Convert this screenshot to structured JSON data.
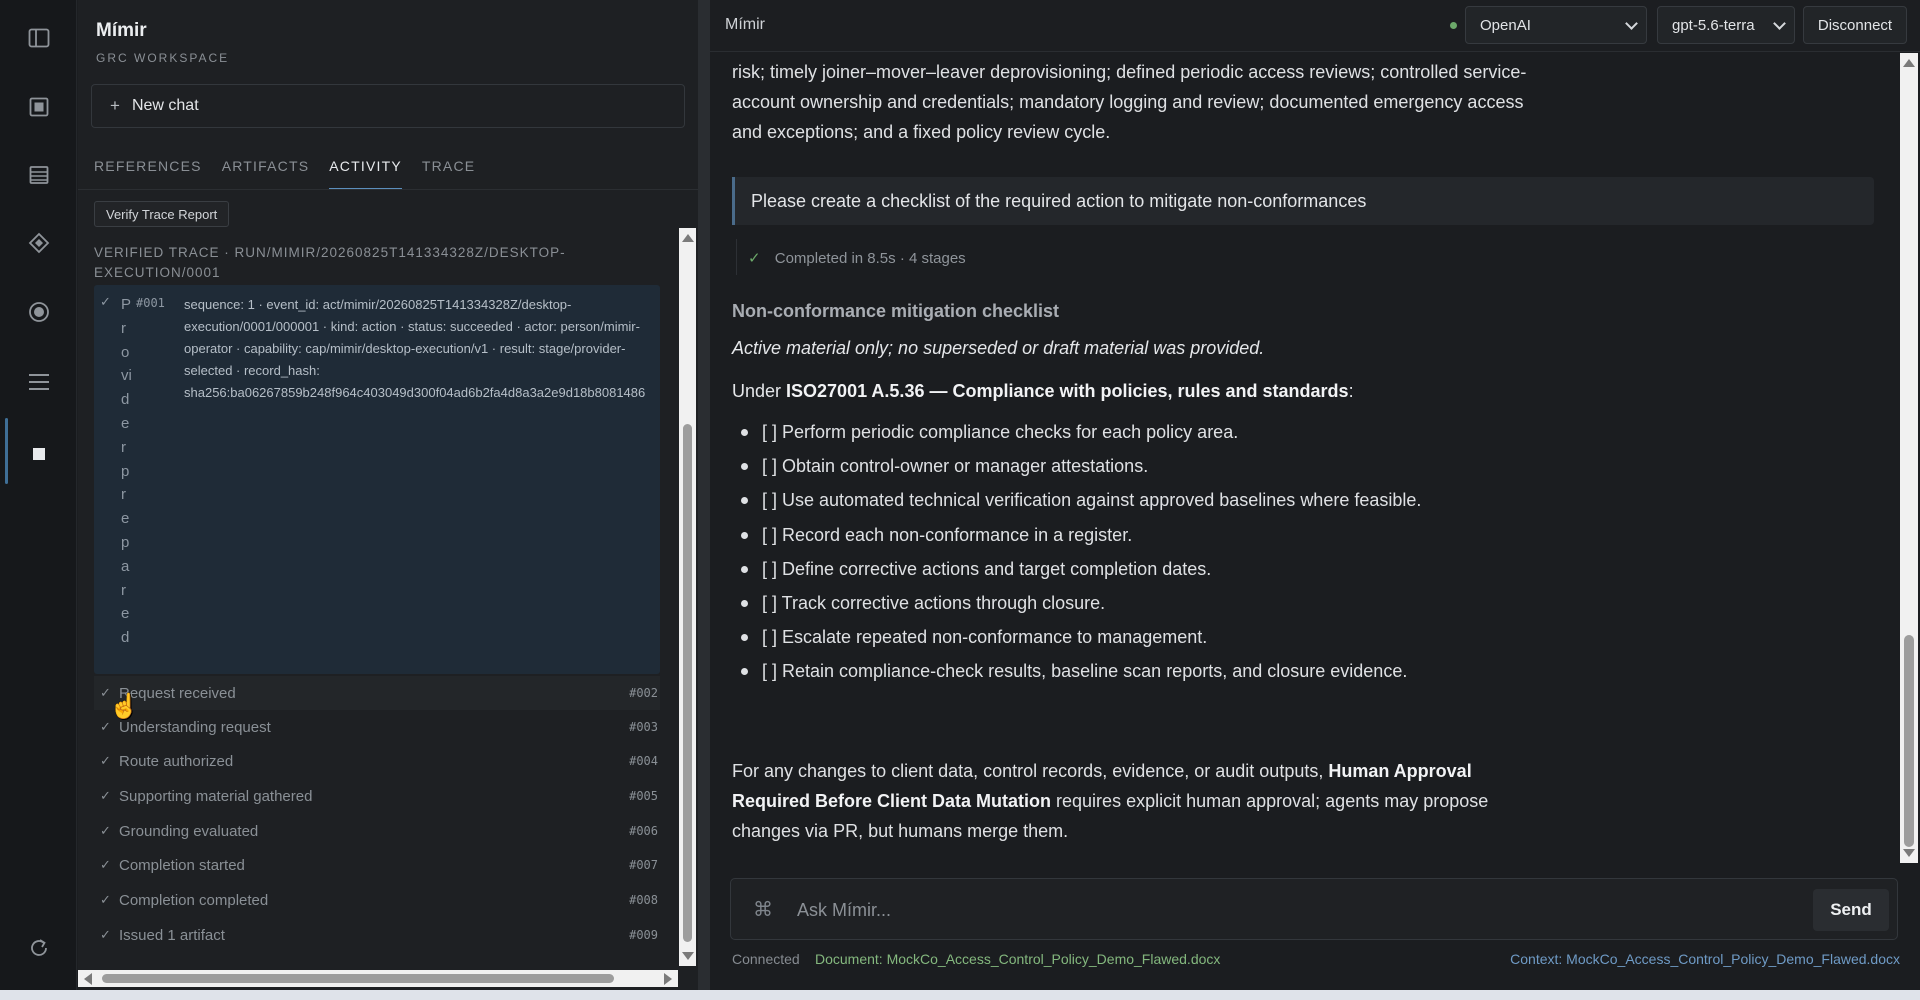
{
  "sidebar": {
    "app_title": "Mímir",
    "workspace": "GRC WORKSPACE",
    "new_chat": "New chat",
    "tabs": [
      {
        "label": "REFERENCES"
      },
      {
        "label": "ARTIFACTS"
      },
      {
        "label": "ACTIVITY"
      },
      {
        "label": "TRACE"
      }
    ],
    "active_tab": "ACTIVITY",
    "verify_button": "Verify Trace Report",
    "trace_header": "VERIFIED TRACE · RUN/MIMIR/20260825T141334328Z/DESKTOP-EXECUTION/0001",
    "expanded_event": {
      "label": "Provider prepared",
      "number": "#001",
      "details": "sequence: 1 · event_id: act/mimir/20260825T141334328Z/desktop-\nexecution/0001/000001 · kind: action · status: succeeded · actor: person/mimir-\noperator · capability: cap/mimir/desktop-execution/v1 · result: stage/provider-\nselected · record_hash:\nsha256:ba06267859b248f964c403049d300f04ad6b2fa4d8a3a2e9d18b8081486"
    },
    "trace_events": [
      {
        "label": "Request received",
        "number": "#002"
      },
      {
        "label": "Understanding request",
        "number": "#003"
      },
      {
        "label": "Route authorized",
        "number": "#004"
      },
      {
        "label": "Supporting material gathered",
        "number": "#005"
      },
      {
        "label": "Grounding evaluated",
        "number": "#006"
      },
      {
        "label": "Completion started",
        "number": "#007"
      },
      {
        "label": "Completion completed",
        "number": "#008"
      },
      {
        "label": "Issued 1 artifact",
        "number": "#009"
      }
    ]
  },
  "topbar": {
    "title": "Mímir",
    "provider": "OpenAI",
    "model": "gpt-5.6-terra",
    "disconnect": "Disconnect"
  },
  "chat": {
    "intro_text": "risk; timely joiner–mover–leaver deprovisioning; defined periodic access reviews; controlled service-account ownership and credentials; mandatory logging and review; documented emergency access and exceptions; and a fixed policy review cycle.",
    "user_prompt": "Please create a checklist of the required action to mitigate non-conformances",
    "completed_status": "Completed in 8.5s · 4 stages",
    "heading": "Non-conformance mitigation checklist",
    "italic_note": "Active material only; no superseded or draft material was provided.",
    "under_prefix": "Under ",
    "under_bold": "ISO27001 A.5.36 — Compliance with policies, rules and standards",
    "under_suffix": ":",
    "checklist": [
      "[ ] Perform periodic compliance checks for each policy area.",
      "[ ] Obtain control-owner or manager attestations.",
      "[ ] Use automated technical verification against approved baselines where feasible.",
      "[ ] Record each non-conformance in a register.",
      "[ ] Define corrective actions and target completion dates.",
      "[ ] Track corrective actions through closure.",
      "[ ] Escalate repeated non-conformance to management.",
      "[ ] Retain compliance-check results, baseline scan reports, and closure evidence."
    ],
    "closing_prefix": "For any changes to client data, control records, evidence, or audit outputs, ",
    "closing_bold": "Human Approval Required Before Client Data Mutation",
    "closing_suffix": " requires explicit human approval; agents may propose changes via PR, but humans merge them."
  },
  "composer": {
    "shortcut_glyph": "⌘",
    "placeholder": "Ask Mímir...",
    "send": "Send"
  },
  "footer": {
    "connection": "Connected",
    "document": "Document: MockCo_Access_Control_Policy_Demo_Flawed.docx",
    "context": "Context: MockCo_Access_Control_Policy_Demo_Flawed.docx"
  },
  "colors": {
    "accent": "#5c8fbd",
    "success": "#6ca96a",
    "link": "#6f9bc6"
  }
}
